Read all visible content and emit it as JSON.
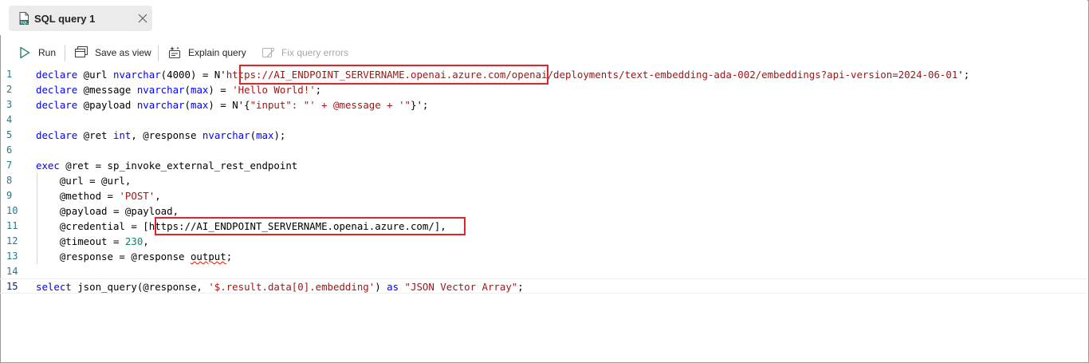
{
  "tab": {
    "title": "SQL query 1",
    "icon": "sql-file-icon",
    "close_icon": "close-icon"
  },
  "toolbar": {
    "run": "Run",
    "save_as_view": "Save as view",
    "explain_query": "Explain query",
    "fix_query_errors": "Fix query errors"
  },
  "editor": {
    "line_numbers": [
      "1",
      "2",
      "3",
      "4",
      "5",
      "6",
      "7",
      "8",
      "9",
      "10",
      "11",
      "12",
      "13",
      "14",
      "15"
    ],
    "lines": [
      [
        [
          "kw",
          "declare"
        ],
        [
          "pl",
          " @url "
        ],
        [
          "kw",
          "nvarchar"
        ],
        [
          "pl",
          "(4000) = N'"
        ],
        [
          "str",
          "https://AI_ENDPOINT_SERVERNAME.openai.azure.com/openai/deployments/text-embedding-ada-002/embeddings?api-version=2024-06-01"
        ],
        [
          "pl",
          "';"
        ]
      ],
      [
        [
          "kw",
          "declare"
        ],
        [
          "pl",
          " @message "
        ],
        [
          "kw",
          "nvarchar"
        ],
        [
          "pl",
          "("
        ],
        [
          "kw",
          "max"
        ],
        [
          "pl",
          ") = "
        ],
        [
          "str",
          "'Hello World!'"
        ],
        [
          "pl",
          ";"
        ]
      ],
      [
        [
          "kw",
          "declare"
        ],
        [
          "pl",
          " @payload "
        ],
        [
          "kw",
          "nvarchar"
        ],
        [
          "pl",
          "("
        ],
        [
          "kw",
          "max"
        ],
        [
          "pl",
          ") = N'{"
        ],
        [
          "str",
          "\"input\": \"' + @message + '\""
        ],
        [
          "pl",
          "}';"
        ]
      ],
      [],
      [
        [
          "kw",
          "declare"
        ],
        [
          "pl",
          " @ret "
        ],
        [
          "kw",
          "int"
        ],
        [
          "pl",
          ", @response "
        ],
        [
          "kw",
          "nvarchar"
        ],
        [
          "pl",
          "("
        ],
        [
          "kw",
          "max"
        ],
        [
          "pl",
          ");"
        ]
      ],
      [],
      [
        [
          "kw",
          "exec"
        ],
        [
          "pl",
          " @ret = sp_invoke_external_rest_endpoint"
        ]
      ],
      [
        [
          "pl",
          "    @url = @url,"
        ]
      ],
      [
        [
          "pl",
          "    @method = "
        ],
        [
          "str",
          "'POST'"
        ],
        [
          "pl",
          ","
        ]
      ],
      [
        [
          "pl",
          "    @payload = @payload,"
        ]
      ],
      [
        [
          "pl",
          "    @credential = [https://AI_ENDPOINT_SERVERNAME.openai.azure.com/],"
        ]
      ],
      [
        [
          "pl",
          "    @timeout = "
        ],
        [
          "num",
          "230"
        ],
        [
          "pl",
          ","
        ]
      ],
      [
        [
          "pl",
          "    @response = @response "
        ],
        [
          "sq",
          "output"
        ],
        [
          "pl",
          ";"
        ]
      ],
      [],
      [
        [
          "kw",
          "select"
        ],
        [
          "pl",
          " json_query(@response, "
        ],
        [
          "str",
          "'$.result.data[0].embedding'"
        ],
        [
          "pl",
          ") "
        ],
        [
          "kw",
          "as"
        ],
        [
          "pl",
          " "
        ],
        [
          "str",
          "\"JSON Vector Array\""
        ],
        [
          "pl",
          ";"
        ]
      ]
    ]
  },
  "colors": {
    "keyword": "#0000ff",
    "string": "#a31515",
    "number": "#098658",
    "highlight_box": "#e0242b",
    "line_number": "#237893"
  }
}
